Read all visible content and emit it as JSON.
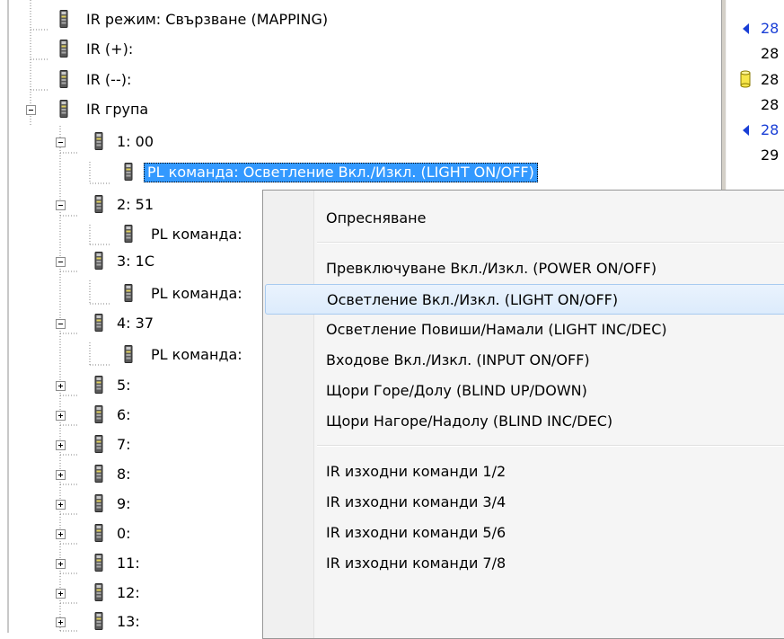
{
  "tree": {
    "nodes": [
      {
        "id": "ir-mode",
        "label": "IR режим: Свързване (MAPPING)"
      },
      {
        "id": "ir-plus",
        "label": "IR (+):"
      },
      {
        "id": "ir-minus",
        "label": "IR (--):"
      },
      {
        "id": "ir-group",
        "label": "IR група"
      },
      {
        "id": "grp-1",
        "label": "1: 00"
      },
      {
        "id": "grp-1-cmd",
        "label": "PL команда: Осветление Вкл./Изкл. (LIGHT ON/OFF)"
      },
      {
        "id": "grp-2",
        "label": "2: 51"
      },
      {
        "id": "grp-2-cmd",
        "label": "PL команда:"
      },
      {
        "id": "grp-3",
        "label": "3: 1C"
      },
      {
        "id": "grp-3-cmd",
        "label": "PL команда:"
      },
      {
        "id": "grp-4",
        "label": "4: 37"
      },
      {
        "id": "grp-4-cmd",
        "label": "PL команда:"
      },
      {
        "id": "grp-5",
        "label": "5:"
      },
      {
        "id": "grp-6",
        "label": "6:"
      },
      {
        "id": "grp-7",
        "label": "7:"
      },
      {
        "id": "grp-8",
        "label": "8:"
      },
      {
        "id": "grp-9",
        "label": "9:"
      },
      {
        "id": "grp-0",
        "label": "0:"
      },
      {
        "id": "grp-11",
        "label": "11:"
      },
      {
        "id": "grp-12",
        "label": "12:"
      },
      {
        "id": "grp-13",
        "label": "13:"
      }
    ]
  },
  "context_menu": {
    "items": [
      {
        "label": "Опресняване"
      },
      {
        "label": "Превключуване Вкл./Изкл. (POWER ON/OFF)"
      },
      {
        "label": "Осветление Вкл./Изкл. (LIGHT ON/OFF)",
        "highlighted": true
      },
      {
        "label": "Осветление Повиши/Намали (LIGHT INC/DEC)"
      },
      {
        "label": "Входове Вкл./Изкл. (INPUT ON/OFF)"
      },
      {
        "label": "Щори Горе/Долу (BLIND UP/DOWN)"
      },
      {
        "label": "Щори Нагоре/Надолу (BLIND INC/DEC)"
      },
      {
        "label": "IR изходни команди 1/2"
      },
      {
        "label": "IR изходни команди 3/4"
      },
      {
        "label": "IR изходни команди 5/6"
      },
      {
        "label": "IR изходни команди 7/8"
      }
    ]
  },
  "right_panel": {
    "rows": [
      {
        "icon": "arrow-left-icon",
        "number": "28",
        "color": "#1a3fd6"
      },
      {
        "icon": "",
        "number": "28",
        "color": "#000000"
      },
      {
        "icon": "cylinder-icon",
        "number": "28",
        "color": "#000000"
      },
      {
        "icon": "",
        "number": "28",
        "color": "#000000"
      },
      {
        "icon": "arrow-left-icon",
        "number": "28",
        "color": "#1a3fd6"
      },
      {
        "icon": "",
        "number": "29",
        "color": "#000000"
      }
    ]
  },
  "colors": {
    "selection": "#3399ff",
    "menu_highlight": "#dcebfc",
    "link_blue": "#1a3fd6"
  }
}
